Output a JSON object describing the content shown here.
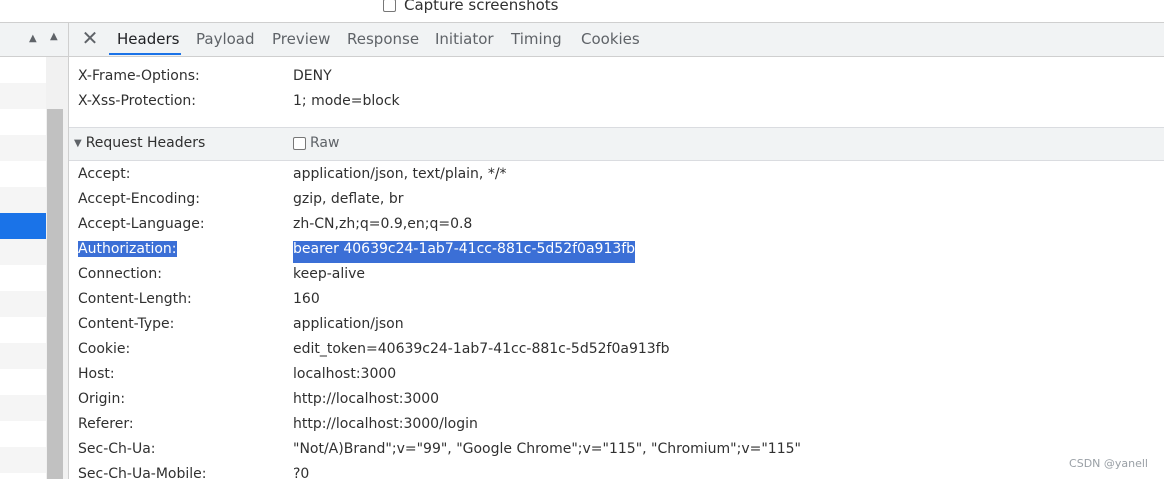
{
  "topbar": {
    "capture_label": "Capture screenshots"
  },
  "tabs": {
    "items": [
      {
        "label": "Headers"
      },
      {
        "label": "Payload"
      },
      {
        "label": "Preview"
      },
      {
        "label": "Response"
      },
      {
        "label": "Initiator"
      },
      {
        "label": "Timing"
      },
      {
        "label": "Cookies"
      }
    ]
  },
  "response_headers": [
    {
      "name": "X-Frame-Options:",
      "value": "DENY"
    },
    {
      "name": "X-Xss-Protection:",
      "value": "1; mode=block"
    }
  ],
  "request_section": {
    "title": "Request Headers",
    "raw_label": "Raw"
  },
  "request_headers": [
    {
      "name": "Accept:",
      "value": "application/json, text/plain, */*"
    },
    {
      "name": "Accept-Encoding:",
      "value": "gzip, deflate, br"
    },
    {
      "name": "Accept-Language:",
      "value": "zh-CN,zh;q=0.9,en;q=0.8"
    },
    {
      "name": "Authorization:",
      "value": "bearer 40639c24-1ab7-41cc-881c-5d52f0a913fb"
    },
    {
      "name": "Connection:",
      "value": "keep-alive"
    },
    {
      "name": "Content-Length:",
      "value": "160"
    },
    {
      "name": "Content-Type:",
      "value": "application/json"
    },
    {
      "name": "Cookie:",
      "value": "edit_token=40639c24-1ab7-41cc-881c-5d52f0a913fb"
    },
    {
      "name": "Host:",
      "value": "localhost:3000"
    },
    {
      "name": "Origin:",
      "value": "http://localhost:3000"
    },
    {
      "name": "Referer:",
      "value": "http://localhost:3000/login"
    },
    {
      "name": "Sec-Ch-Ua:",
      "value": "\"Not/A)Brand\";v=\"99\", \"Google Chrome\";v=\"115\", \"Chromium\";v=\"115\""
    },
    {
      "name": "Sec-Ch-Ua-Mobile:",
      "value": "?0"
    }
  ],
  "watermark": "CSDN @yanell",
  "colors": {
    "accent": "#1a73e8",
    "selection": "#3b6fd6"
  },
  "icons": {
    "close": "close-icon",
    "sort": "sort-up-icon"
  }
}
